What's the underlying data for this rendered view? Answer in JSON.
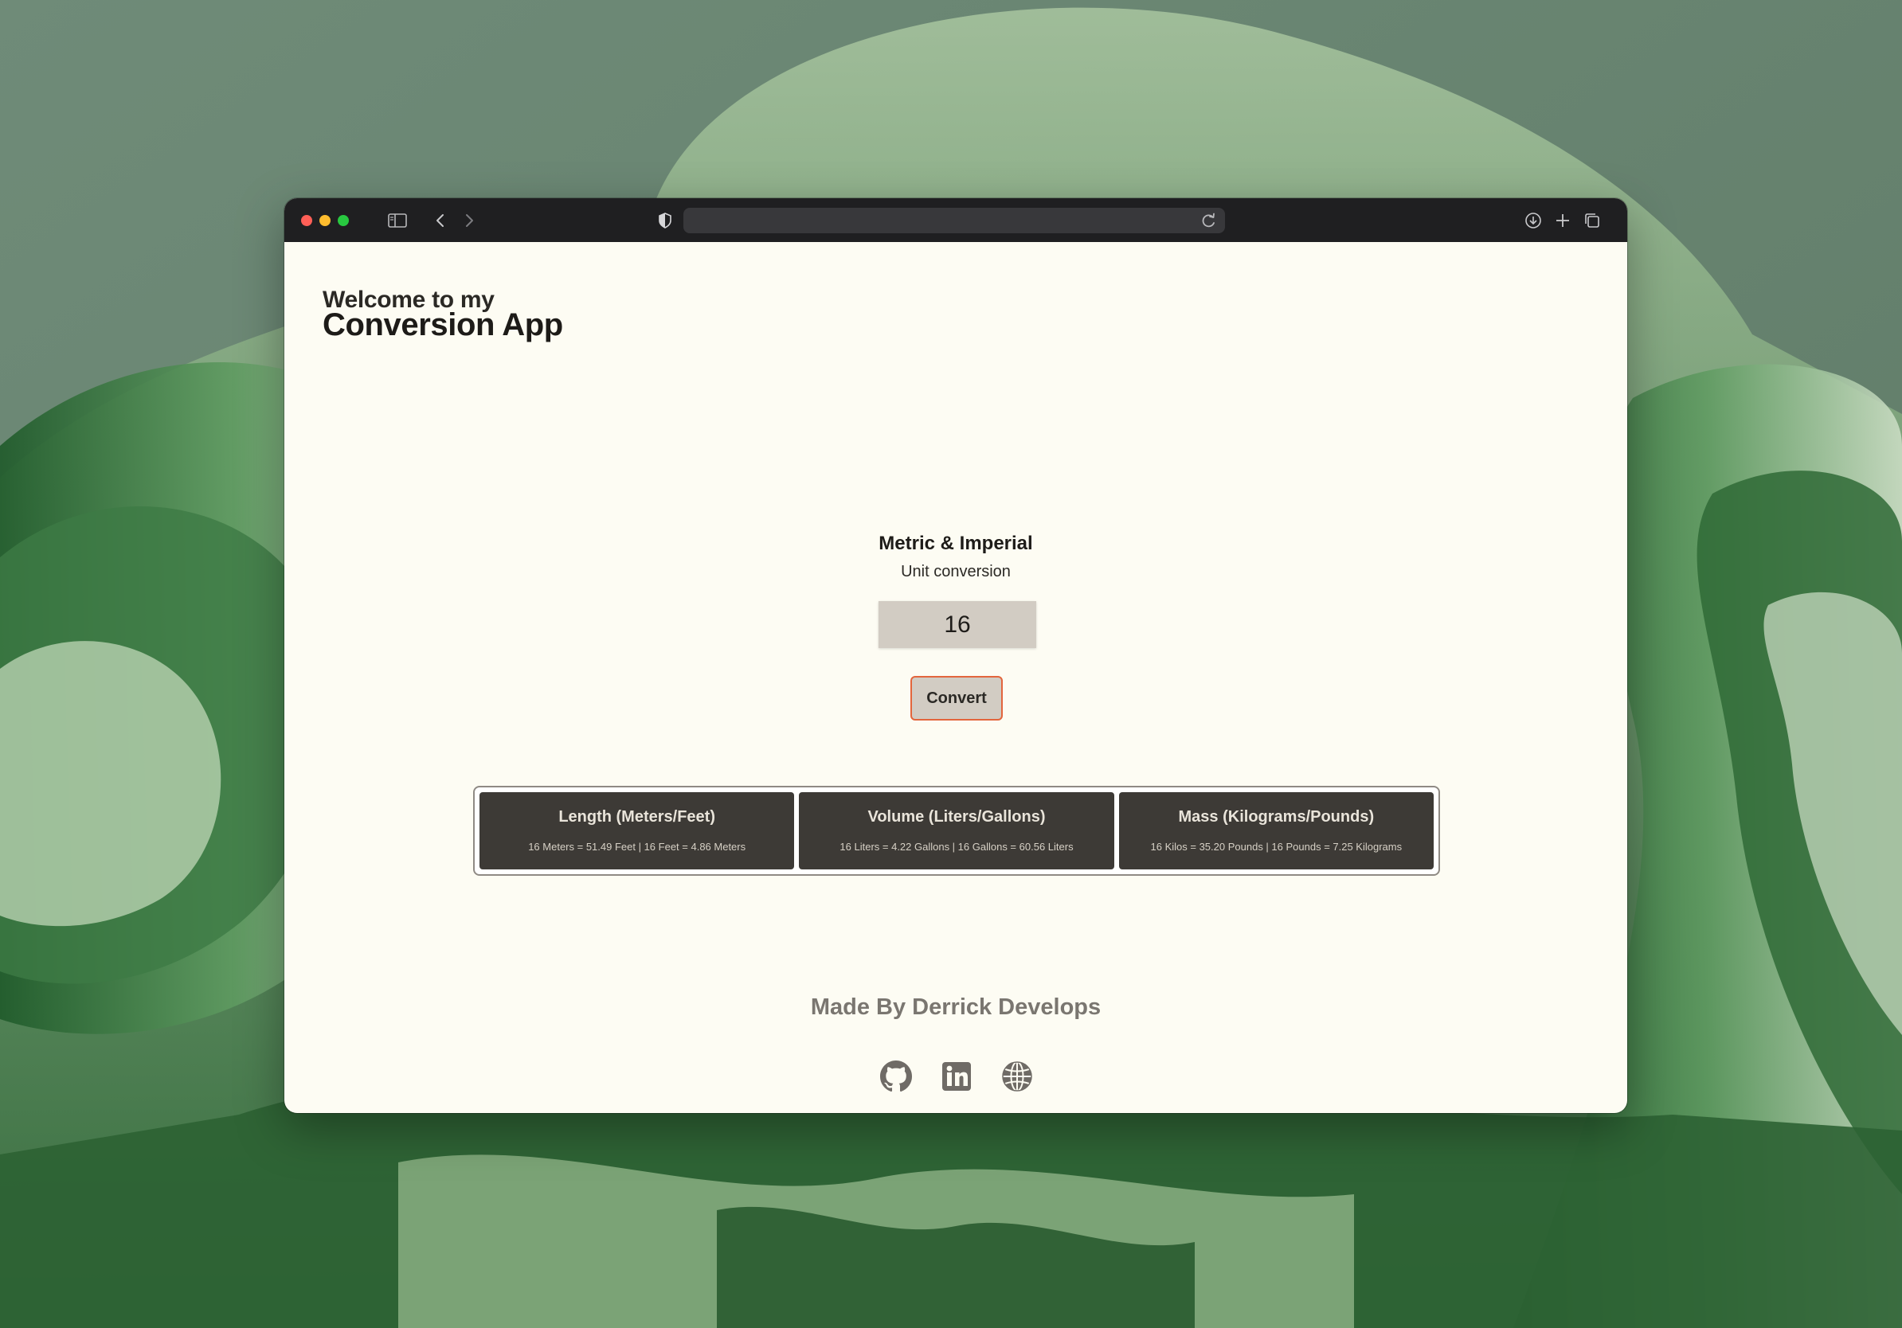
{
  "browser": {
    "url": ""
  },
  "page": {
    "welcome_line1": "Welcome to my",
    "welcome_line2": "Conversion App",
    "heading": "Metric & Imperial",
    "subheading": "Unit conversion",
    "input_value": "16",
    "convert_label": "Convert",
    "results": [
      {
        "title": "Length (Meters/Feet)",
        "body": "16 Meters = 51.49 Feet | 16 Feet = 4.86 Meters"
      },
      {
        "title": "Volume (Liters/Gallons)",
        "body": "16 Liters = 4.22 Gallons | 16 Gallons = 60.56 Liters"
      },
      {
        "title": "Mass (Kilograms/Pounds)",
        "body": "16 Kilos = 35.20 Pounds | 16 Pounds = 7.25 Kilograms"
      }
    ],
    "footer": "Made By Derrick Develops",
    "social_icons": [
      "github-icon",
      "linkedin-icon",
      "globe-icon"
    ]
  },
  "colors": {
    "page_background": "#fdfcf3",
    "card_background": "#3d3a36",
    "accent_border": "#e3653c",
    "input_background": "#d2ccc3"
  }
}
